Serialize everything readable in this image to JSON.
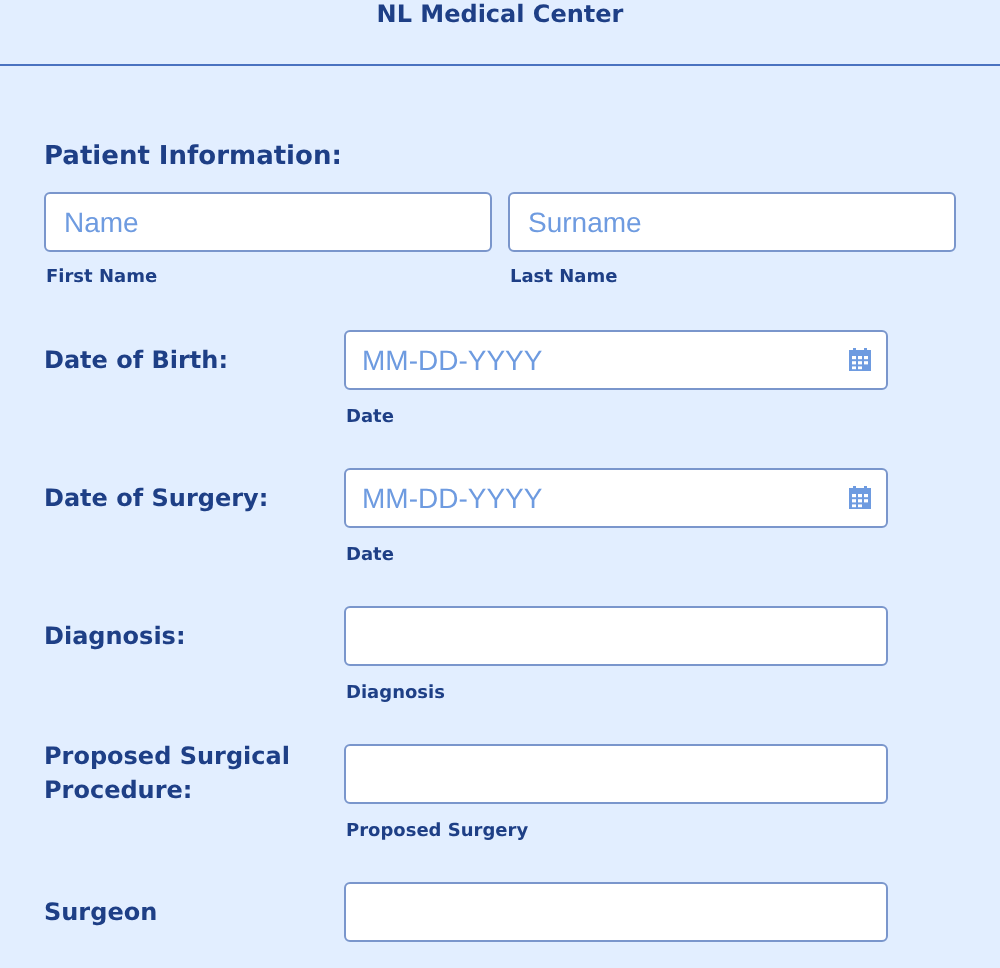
{
  "header": {
    "title": "NL Medical Center"
  },
  "patient_information": {
    "heading": "Patient Information:",
    "fields": [
      {
        "placeholder": "Name",
        "sublabel": "First Name"
      },
      {
        "placeholder": "Surname",
        "sublabel": "Last Name"
      }
    ]
  },
  "rows": [
    {
      "label": "Date of Birth:",
      "kind": "date",
      "placeholder": "MM-DD-YYYY",
      "sublabel": "Date"
    },
    {
      "label": "Date of Surgery:",
      "kind": "date",
      "placeholder": "MM-DD-YYYY",
      "sublabel": "Date"
    },
    {
      "label": "Diagnosis:",
      "kind": "text",
      "sublabel": "Diagnosis"
    },
    {
      "label": "Proposed Surgical Procedure:",
      "kind": "text",
      "sublabel": "Proposed Surgery"
    },
    {
      "label": "Surgeon",
      "kind": "text"
    }
  ]
}
